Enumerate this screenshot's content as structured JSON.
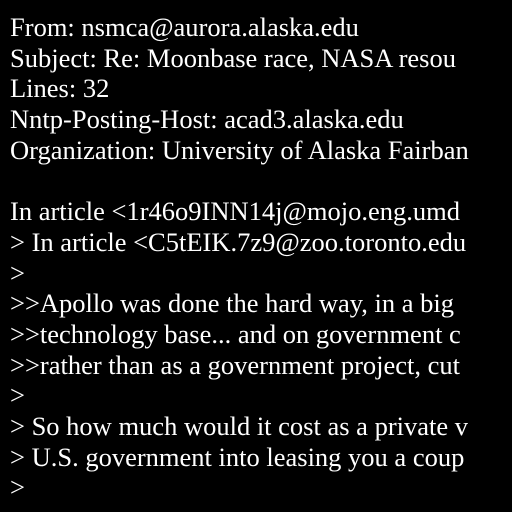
{
  "document": {
    "background_color": "#000000",
    "text_color": "#ffffff",
    "lines": [
      "From: nsmca@aurora.alaska.edu",
      "Subject: Re: Moonbase race, NASA resou",
      "Lines: 32",
      "Nntp-Posting-Host: acad3.alaska.edu",
      "Organization: University of Alaska Fairban",
      "",
      "In article <1r46o9INN14j@mojo.eng.umd",
      "> In article <C5tEIK.7z9@zoo.toronto.edu",
      ">",
      ">>Apollo was done the hard way, in a big",
      ">>technology base... and on government c",
      ">>rather than as a government project, cut",
      ">",
      "> So how much would it cost as a private v",
      "> U.S. government into leasing you a coup",
      ">"
    ]
  }
}
